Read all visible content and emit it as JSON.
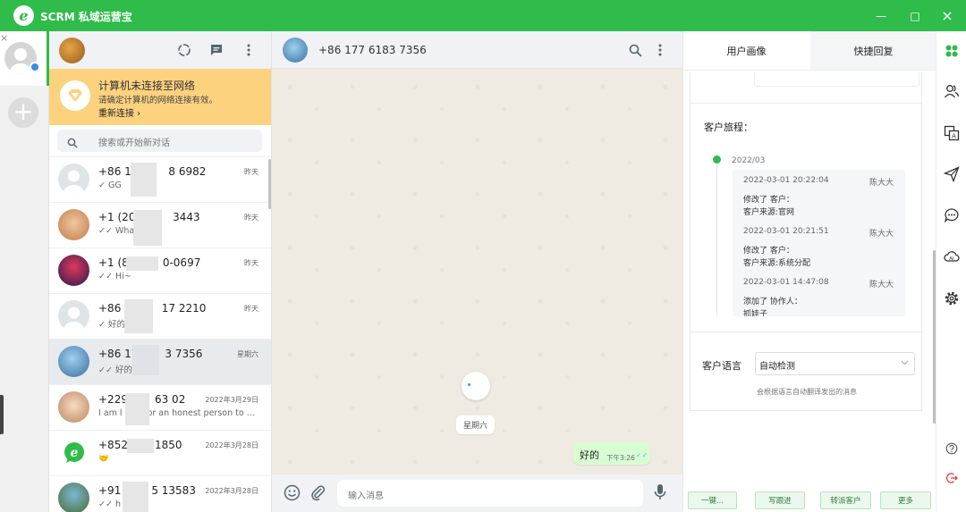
{
  "app": {
    "title": "SCRM 私域运营宝",
    "logo_letter": "e",
    "accent": "#2fbc4a"
  },
  "window": {
    "minimize": "—",
    "maximize": "□",
    "close": "×"
  },
  "accounts": {
    "close": "×",
    "add": "+"
  },
  "sidebar": {
    "banner": {
      "title": "计算机未连接至网络",
      "desc": "请确定计算机的网络连接有效。",
      "link": "重新连接 ›"
    },
    "search_placeholder": "搜索或开始新对话",
    "chats": [
      {
        "name": "+86 15",
        "name_tail": "8 6982",
        "preview": "✓ GG",
        "time": "昨天"
      },
      {
        "name": "+1 (206",
        "name_tail": "3443",
        "preview": "✓✓ Whats",
        "time": "昨天"
      },
      {
        "name": "+1 (8",
        "name_tail": "0-0697",
        "preview": "✓✓ Hi~",
        "time": "昨天"
      },
      {
        "name": "+86 1",
        "name_tail": "17 2210",
        "preview": "✓ 好的",
        "time": "昨天"
      },
      {
        "name": "+86 17",
        "name_tail": "3 7356",
        "preview": "✓✓ 好的",
        "time": "星期六"
      },
      {
        "name": "+229",
        "name_tail": "63 02",
        "preview": "I am l",
        "preview_tail": "or an honest person to ...",
        "time": "2022年3月29日"
      },
      {
        "name": "+852",
        "name_tail": "1850",
        "preview": "🤝",
        "time": "2022年3月28日"
      },
      {
        "name": "+91",
        "name_tail": "5 13583",
        "preview": "✓✓ h",
        "time": "2022年3月28日"
      }
    ]
  },
  "conversation": {
    "title": "+86 177 6183 7356",
    "day_label": "星期六",
    "message": {
      "text": "好的",
      "time": "下午3:26",
      "status": "✓✓"
    },
    "input_placeholder": "输入消息"
  },
  "panel": {
    "tabs": [
      "用户画像",
      "快捷回复"
    ],
    "journey_title": "客户旅程：",
    "month": "2022/03",
    "events": [
      {
        "time": "2022-03-01 20:22:04",
        "user": "陈大大",
        "line1": "修改了 客户：",
        "line2": "客户来源:官网"
      },
      {
        "time": "2022-03-01 20:21:51",
        "user": "陈大大",
        "line1": "修改了 客户：",
        "line2": "客户来源:系统分配"
      },
      {
        "time": "2022-03-01 14:47:08",
        "user": "陈大大",
        "line1": "添加了 协作人：",
        "line2": "抓娃子"
      }
    ],
    "language_label": "客户语言",
    "language_value": "自动检测",
    "language_hint": "会根据语言自动翻译发出的消息",
    "actions": [
      "一键...",
      "写跟进",
      "转派客户",
      "更多"
    ]
  }
}
